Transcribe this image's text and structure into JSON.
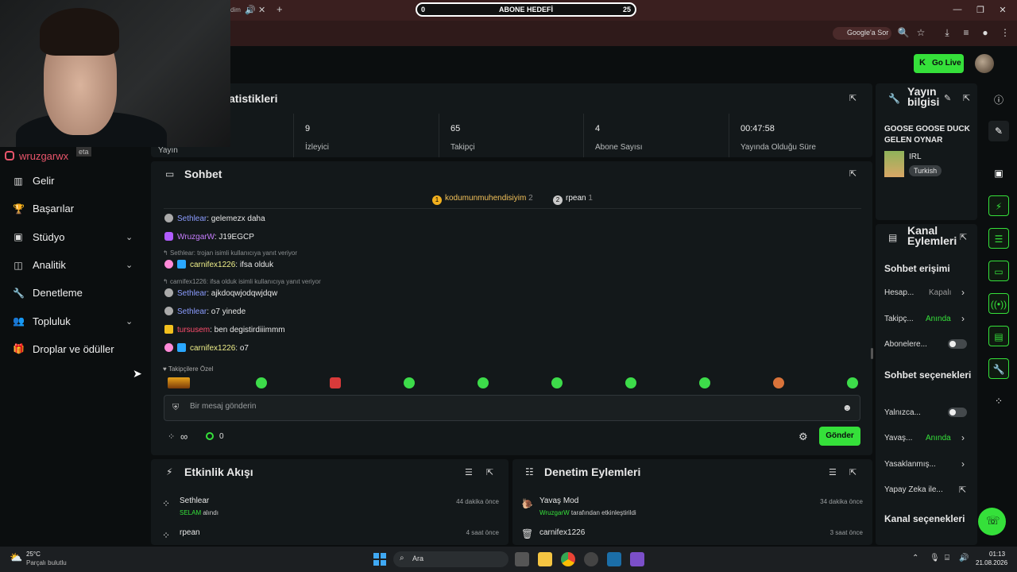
{
  "browser": {
    "tab_partial_text": "dim",
    "goal": {
      "label": "ABONE HEDEFİ",
      "current": "0",
      "target": "25",
      "progress_fraction": 0.0
    },
    "google_sor": "Google'a Sor"
  },
  "header": {
    "go_live_label": "Go Live"
  },
  "webcam": {
    "instagram_handle": "wruzgarwx",
    "overlay_partial": "eta"
  },
  "sidebar": {
    "items": [
      {
        "label": "Gelir",
        "icon": "chart-icon"
      },
      {
        "label": "Başarılar",
        "icon": "trophy-icon"
      },
      {
        "label": "Stüdyo",
        "icon": "studio-icon"
      },
      {
        "label": "Analitik",
        "icon": "analytics-icon"
      },
      {
        "label": "Denetleme",
        "icon": "wrench-icon"
      },
      {
        "label": "Topluluk",
        "icon": "community-icon"
      },
      {
        "label": "Droplar ve ödüller",
        "icon": "gift-icon"
      }
    ]
  },
  "stats": {
    "title_partial": "atistikleri",
    "first_label_partial": "Yayın",
    "cells": [
      {
        "value": "9",
        "label": "İzleyici"
      },
      {
        "value": "65",
        "label": "Takipçi"
      },
      {
        "value": "4",
        "label": "Abone Sayısı"
      },
      {
        "value": "00:47:58",
        "label": "Yayında Olduğu Süre"
      }
    ]
  },
  "chat": {
    "title": "Sohbet",
    "top_chatters": [
      {
        "rank": "1",
        "name": "kodumunmuhendisiyim",
        "count": "2"
      },
      {
        "rank": "2",
        "name": "rpean",
        "count": "1"
      }
    ],
    "messages": [
      {
        "user": "Sethlear",
        "text": ": gelemezx daha",
        "color": "#8b9cff"
      },
      {
        "user": "WruzgarW",
        "text": ": J19EGCP",
        "color": "#c77dff"
      },
      {
        "reply": "Sethlear: trojan isimli kullanıcıya yanıt veriyor"
      },
      {
        "user": "carnifex1226",
        "text": ": ifsa olduk",
        "color": "#f0f08a"
      },
      {
        "reply": "carnifex1226: ifsa olduk isimli kullanıcıya yanıt veriyor"
      },
      {
        "user": "Sethlear",
        "text": ": ajkdoqwjodqwjdqw",
        "color": "#8b9cff"
      },
      {
        "user": "Sethlear",
        "text": ": o7 yinede",
        "color": "#8b9cff"
      },
      {
        "user": "tursusem",
        "text": ": ben degistirdiiimmm",
        "color": "#ff4d6d"
      },
      {
        "user": "carnifex1226",
        "text": ": o7",
        "color": "#f0f08a"
      }
    ],
    "favorites_label": "Takipçilere Özel",
    "input_placeholder": "Bir mesaj gönderin",
    "points_value": "0",
    "infinity": "∞",
    "send_label": "Gönder"
  },
  "activity": {
    "title": "Etkinlik Akışı",
    "items": [
      {
        "user": "Sethlear",
        "detail_highlight": "SELAM",
        "detail": " alındı",
        "time": "44 dakika önce"
      },
      {
        "user": "rpean",
        "time": "4 saat önce"
      }
    ]
  },
  "modlog": {
    "title": "Denetim Eylemleri",
    "items": [
      {
        "title": "Yavaş Mod",
        "actor": "WruzgarW",
        "detail": " tarafından etkinleştirildi",
        "time": "34 dakika önce"
      },
      {
        "title": "carnifex1226",
        "time": "3 saat önce"
      }
    ]
  },
  "stream_info": {
    "title": "Yayın bilgisi",
    "stream_title": "GOOSE GOOSE DUCK GELEN OYNAR",
    "category": "IRL",
    "tag": "Turkish"
  },
  "channel_actions": {
    "title": "Kanal Eylemleri",
    "chat_access_heading": "Sohbet erişimi",
    "rows": [
      {
        "label": "Hesap...",
        "value": "Kapalı"
      },
      {
        "label": "Takipç...",
        "value": "Anında"
      },
      {
        "label": "Abonelere..."
      }
    ],
    "chat_options_heading": "Sohbet seçenekleri",
    "options_rows": [
      {
        "label": "Yalnızca..."
      },
      {
        "label": "Yavaş...",
        "value": "Anında"
      },
      {
        "label": "Yasaklanmış..."
      },
      {
        "label": "Yapay Zeka ile..."
      }
    ],
    "channel_options_heading": "Kanal seçenekleri"
  },
  "taskbar": {
    "weather_temp": "25°C",
    "weather_desc": "Parçalı bulutlu",
    "search_label": "Ara",
    "time": "01:13",
    "date": "21.08.2026"
  }
}
